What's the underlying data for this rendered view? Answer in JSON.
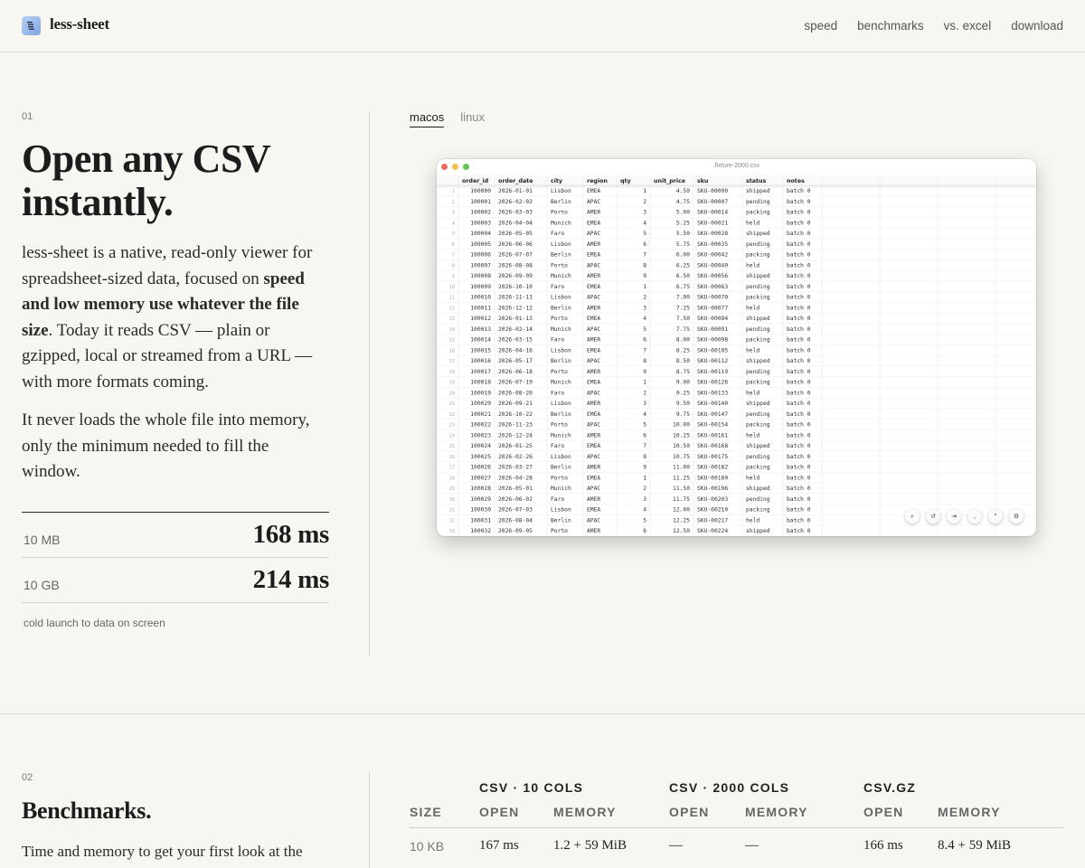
{
  "brand": {
    "name": "less-sheet",
    "logo_icon": "spreadsheet-logo-icon"
  },
  "nav": [
    "speed",
    "benchmarks",
    "vs. excel",
    "download"
  ],
  "hero": {
    "section_num": "01",
    "title_line1": "Open any CSV",
    "title_line2": "instantly.",
    "p1_a": "less-sheet is a native, read-only viewer for spreadsheet-sized data, focused on ",
    "p1_b": "speed and low memory use whatever the file size",
    "p1_c": ". Today it reads CSV — plain or gzipped, local or streamed from a URL — with more formats coming.",
    "p2": "It never loads the whole file into memory, only the minimum needed to fill the window.",
    "stats": [
      {
        "label": "10 MB",
        "value": "168 ms"
      },
      {
        "label": "10 GB",
        "value": "214 ms"
      }
    ],
    "stats_note": "cold launch to data on screen"
  },
  "os_tabs": {
    "items": [
      "macos",
      "linux"
    ],
    "active": "macos"
  },
  "app": {
    "window_title": ".fixture-2000.csv",
    "columns": [
      "order_id",
      "order_date",
      "city",
      "region",
      "qty",
      "unit_price",
      "sku",
      "status",
      "notes"
    ],
    "row_count_visible": 33,
    "row_start": 1,
    "first_order_id": 100000,
    "cities": [
      "Lisbon",
      "Berlin",
      "Porto",
      "Munich",
      "Faro"
    ],
    "regions": [
      "EMEA",
      "APAC",
      "AMER"
    ],
    "statuses": [
      "shipped",
      "pending",
      "packing",
      "held"
    ],
    "notes_value": "batch 0",
    "toolbar_icons": [
      "search-icon",
      "undo-icon",
      "jump-icon",
      "comma-icon",
      "quote-icon",
      "settings-icon"
    ],
    "traffic_light_colors": [
      "#ec6a5e",
      "#f4bf4f",
      "#61c554"
    ]
  },
  "benchmarks": {
    "section_num": "02",
    "title": "Benchmarks.",
    "body": "Time and memory to get your first look at the",
    "groups": [
      "CSV · 10 COLS",
      "CSV · 2000 COLS",
      "CSV.GZ"
    ],
    "headers": [
      "SIZE",
      "OPEN",
      "MEMORY",
      "OPEN",
      "MEMORY",
      "OPEN",
      "MEMORY"
    ],
    "rows": [
      [
        "10 KB",
        "167 ms",
        "1.2 + 59 MiB",
        "—",
        "—",
        "166 ms",
        "8.4 + 59 MiB"
      ]
    ]
  }
}
